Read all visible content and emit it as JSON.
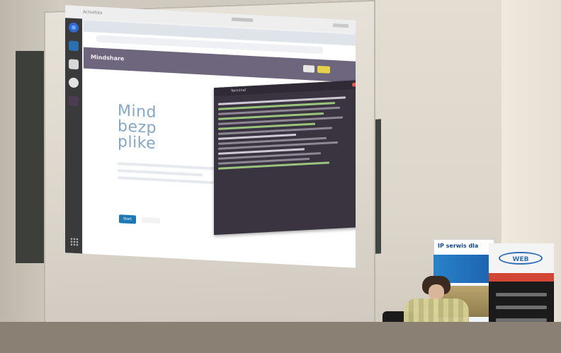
{
  "screen": {
    "desktop": {
      "top_bar": {
        "activities_label": "Activities"
      },
      "dock": {
        "icons": [
          "chrome-icon",
          "vscode-icon",
          "files-icon",
          "disc-icon",
          "terminal-icon"
        ],
        "apps_grid_icon": "apps-grid-icon"
      },
      "browser": {
        "site_title": "Mindshare",
        "hero_lines": [
          "Mind",
          "bezp",
          "plike"
        ],
        "primary_button_label": "Start",
        "accent_color": "#1f78b6",
        "header_color": "#6e667c",
        "header_button_color": "#e5d248"
      },
      "terminal": {
        "title": "Terminal",
        "line_colors": {
          "default": "#8f8796",
          "green": "#9ac47c",
          "white": "#cfc8d6"
        }
      }
    }
  },
  "banners": [
    {
      "name": "banner-left",
      "title": "IP serwis dla"
    },
    {
      "name": "banner-right",
      "logo_text": "WEB"
    }
  ]
}
